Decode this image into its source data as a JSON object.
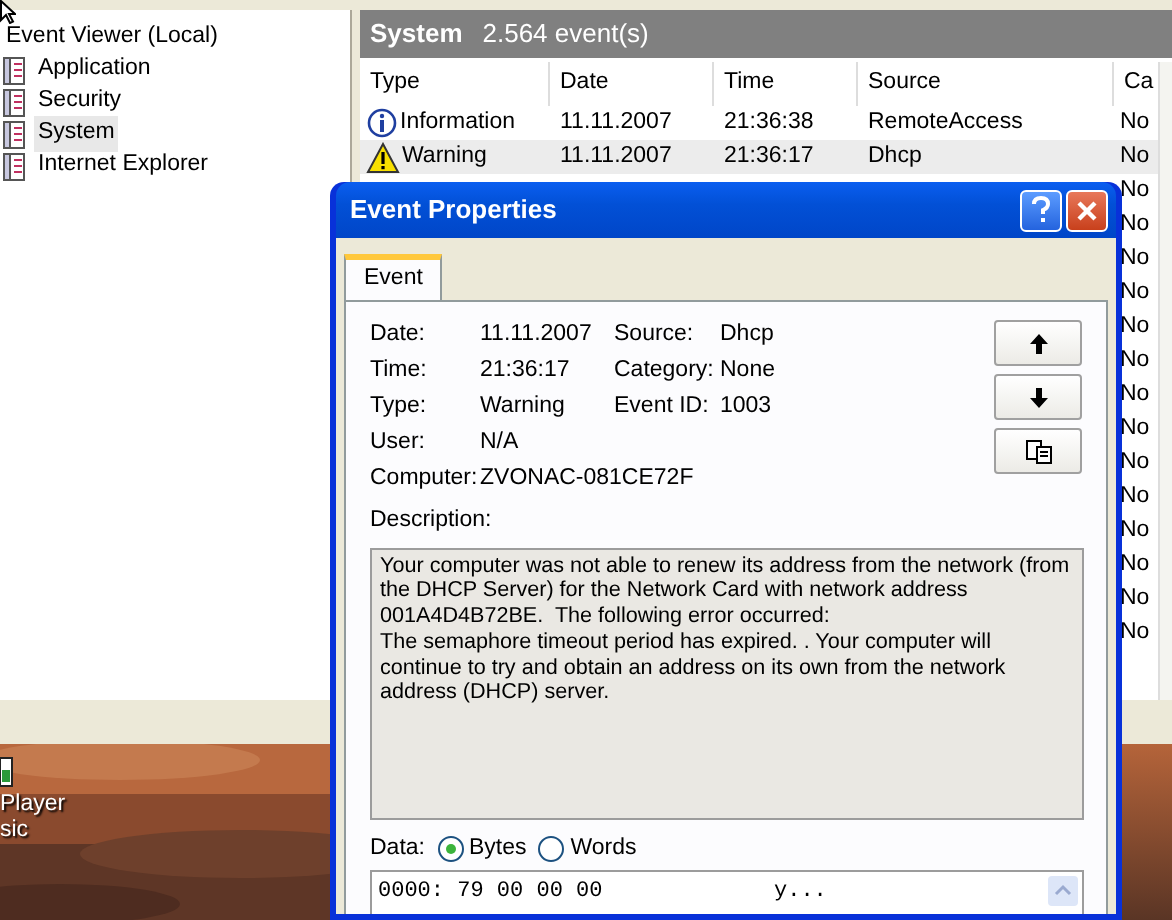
{
  "tree": {
    "root": "Event Viewer (Local)",
    "items": [
      {
        "label": "Application",
        "selected": false
      },
      {
        "label": "Security",
        "selected": false
      },
      {
        "label": "System",
        "selected": true
      },
      {
        "label": "Internet Explorer",
        "selected": false
      }
    ]
  },
  "pane": {
    "title": "System",
    "count": "2.564 event(s)"
  },
  "table": {
    "columns": [
      "Type",
      "Date",
      "Time",
      "Source",
      "Ca"
    ],
    "rows": [
      {
        "kind": "information",
        "type": "Information",
        "date": "11.11.2007",
        "time": "21:36:38",
        "source": "RemoteAccess",
        "category": "No",
        "selected": false
      },
      {
        "kind": "warning",
        "type": "Warning",
        "date": "11.11.2007",
        "time": "21:36:17",
        "source": "Dhcp",
        "category": "No",
        "selected": true
      },
      {
        "kind": "covered",
        "category": "No",
        "selected": false
      },
      {
        "kind": "covered",
        "category": "No",
        "selected": false
      },
      {
        "kind": "covered",
        "category": "No",
        "selected": false
      },
      {
        "kind": "covered",
        "category": "No",
        "selected": false
      },
      {
        "kind": "covered",
        "category": "No",
        "selected": false
      },
      {
        "kind": "covered",
        "category": "No",
        "selected": false
      },
      {
        "kind": "covered",
        "category": "No",
        "selected": false
      },
      {
        "kind": "covered",
        "category": "No",
        "selected": false
      },
      {
        "kind": "covered",
        "category": "No",
        "selected": false
      },
      {
        "kind": "covered",
        "category": "No",
        "selected": false
      },
      {
        "kind": "covered",
        "category": "No",
        "selected": false
      },
      {
        "kind": "covered",
        "category": "No",
        "selected": false
      },
      {
        "kind": "covered",
        "category": "No",
        "selected": false
      },
      {
        "kind": "covered",
        "category": "No",
        "selected": false
      }
    ]
  },
  "dialog": {
    "title": "Event Properties",
    "tabs": [
      {
        "label": "Event",
        "selected": true
      }
    ],
    "fields_left": [
      {
        "label": "Date:",
        "value": "11.11.2007"
      },
      {
        "label": "Time:",
        "value": "21:36:17"
      },
      {
        "label": "Type:",
        "value": "Warning"
      },
      {
        "label": "User:",
        "value": "N/A"
      },
      {
        "label": "Computer:",
        "value": "ZVONAC-081CE72F"
      }
    ],
    "fields_right": [
      {
        "label": "Source:",
        "value": "Dhcp"
      },
      {
        "label": "Category:",
        "value": "None"
      },
      {
        "label": "Event ID:",
        "value": "1003"
      }
    ],
    "description_label": "Description:",
    "description": "Your computer was not able to renew its address from the network (from the DHCP Server) for the Network Card with network address 001A4D4B72BE.  The following error occurred: \nThe semaphore timeout period has expired. . Your computer will continue to try and obtain an address on its own from the network address (DHCP) server.",
    "data_label": "Data:",
    "data_format": [
      {
        "label": "Bytes",
        "selected": true
      },
      {
        "label": "Words",
        "selected": false
      }
    ],
    "data_lines": [
      {
        "hex": "0000: 79 00 00 00",
        "ascii": "y..."
      }
    ]
  },
  "desktop": {
    "labels": [
      "Player",
      "sic"
    ]
  }
}
